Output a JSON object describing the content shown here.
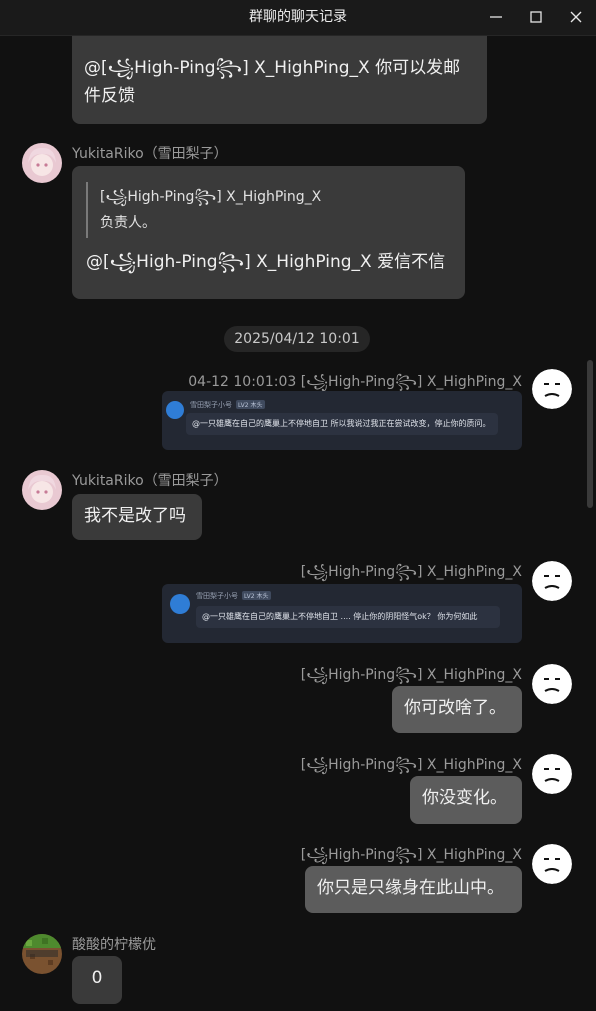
{
  "window": {
    "title": "群聊的聊天记录",
    "controls": [
      "minimize-icon",
      "maximize-icon",
      "close-icon"
    ]
  },
  "messages": [
    {
      "id": "m0",
      "side": "left",
      "text": "@[꧁High-Ping꧂] X_HighPing_X 你可以发邮件反馈"
    },
    {
      "id": "m1",
      "side": "left",
      "sender": "YukitaRiko（雪田梨子）",
      "quote": {
        "author": "[꧁High-Ping꧂] X_HighPing_X",
        "text": "负责人。"
      },
      "text": "@[꧁High-Ping꧂] X_HighPing_X 爱信不信"
    },
    {
      "id": "m2",
      "side": "right",
      "sender": "04-12 10:01:03 [꧁High-Ping꧂] X_HighPing_X",
      "image": {
        "name": "雪田梨子小号",
        "level": "LV2 木头",
        "text": "@一只雄鹰在自己的鹰巢上不停地自卫 所以我说过我正在尝试改变，停止你的质问。"
      }
    },
    {
      "id": "m3",
      "side": "left",
      "sender": "YukitaRiko（雪田梨子）",
      "text": "我不是改了吗"
    },
    {
      "id": "m4",
      "side": "right",
      "sender": "[꧁High-Ping꧂] X_HighPing_X",
      "image": {
        "name": "雪田梨子小号",
        "level": "LV2 木头",
        "text": "@一只雄鹰在自己的鹰巢上不停地自卫 .... 停止你的阴阳怪气ok？ 你为何如此"
      }
    },
    {
      "id": "m5",
      "side": "right",
      "sender": "[꧁High-Ping꧂] X_HighPing_X",
      "text": "你可改啥了。"
    },
    {
      "id": "m6",
      "side": "right",
      "sender": "[꧁High-Ping꧂] X_HighPing_X",
      "text": "你没变化。"
    },
    {
      "id": "m7",
      "side": "right",
      "sender": "[꧁High-Ping꧂] X_HighPing_X",
      "text": "你只是只缘身在此山中。"
    },
    {
      "id": "m8",
      "side": "left",
      "sender": "酸酸的柠檬优",
      "text": "0"
    }
  ],
  "time_divider": "2025/04/12 10:01",
  "avatars": {
    "yukita": "anime-girl-avatar",
    "highping": "face-avatar",
    "lemon": "minecraft-avatar"
  },
  "colors": {
    "background": "#111111",
    "bubble_other": "#3a3a3a",
    "bubble_self": "#5c5c5c",
    "sender_text": "#9a9a9a"
  }
}
